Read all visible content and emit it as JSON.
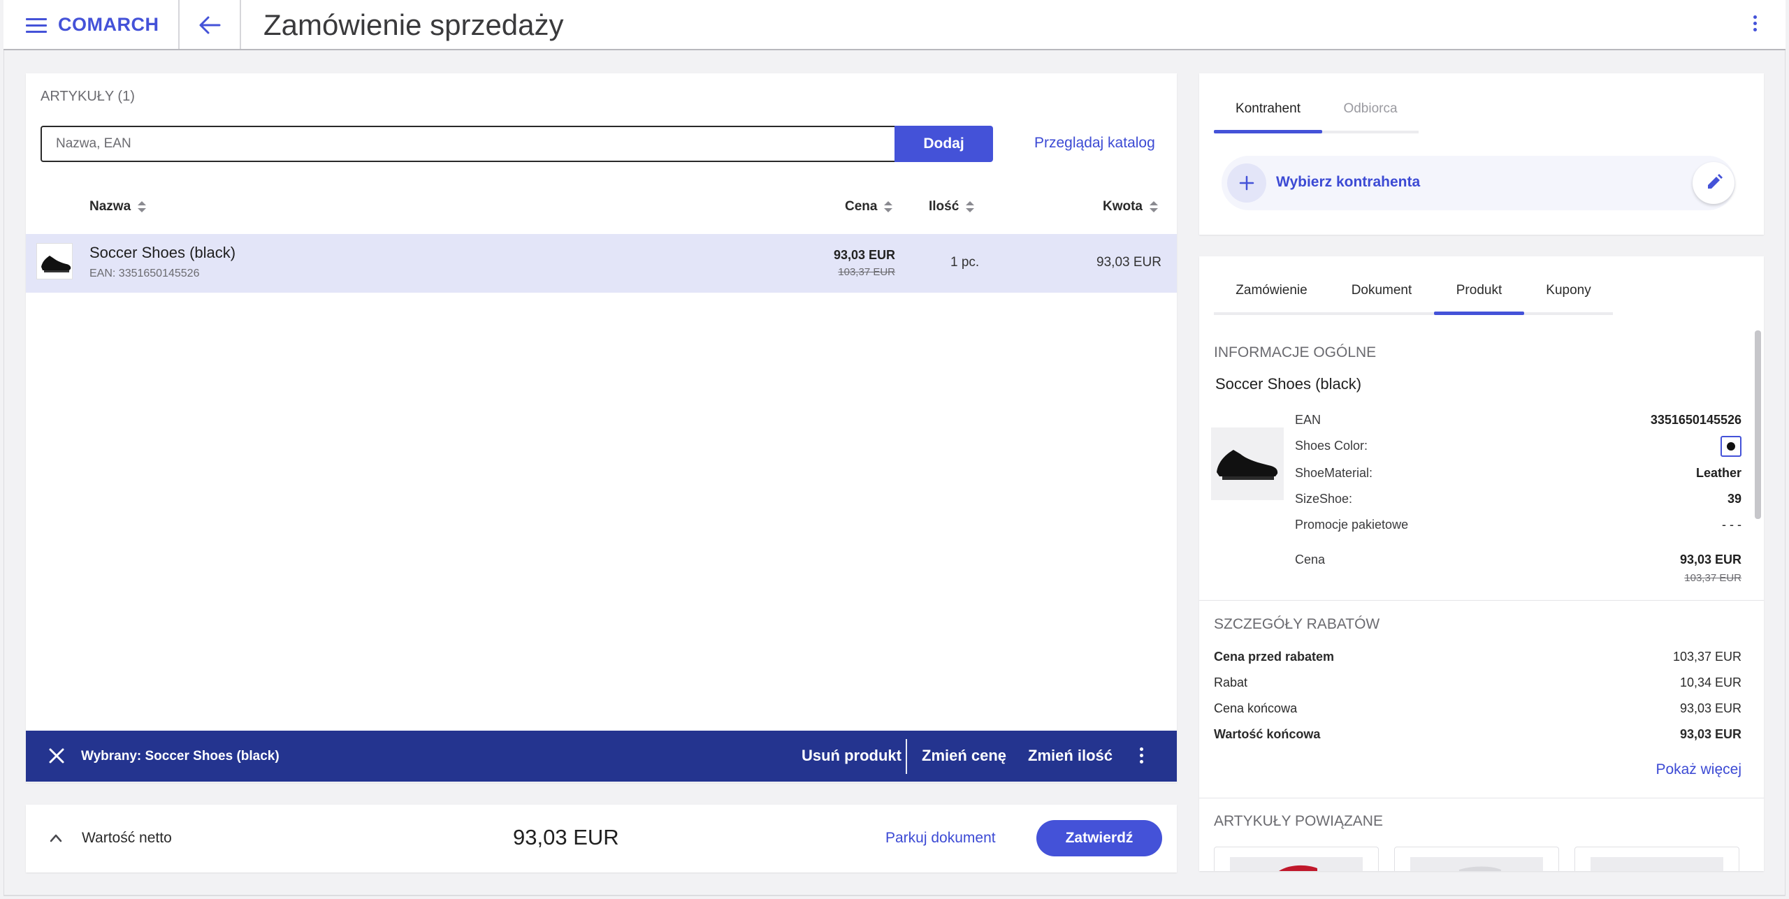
{
  "header": {
    "logo": "COMARCH",
    "title": "Zamówienie sprzedaży"
  },
  "articles": {
    "title": "ARTYKUŁY (1)",
    "search_placeholder": "Nazwa, EAN",
    "add_label": "Dodaj",
    "catalog_label": "Przeglądaj katalog",
    "columns": {
      "name": "Nazwa",
      "price": "Cena",
      "qty": "Ilość",
      "amount": "Kwota"
    },
    "rows": [
      {
        "name": "Soccer Shoes (black)",
        "ean": "EAN: 3351650145526",
        "price": "93,03 EUR",
        "old_price": "103,37 EUR",
        "qty": "1 pc.",
        "amount": "93,03 EUR"
      }
    ]
  },
  "selection_bar": {
    "label": "Wybrany: Soccer Shoes (black)",
    "remove": "Usuń produkt",
    "change_price": "Zmień cenę",
    "change_qty": "Zmień ilość"
  },
  "footer": {
    "net_label": "Wartość netto",
    "net_value": "93,03 EUR",
    "park_label": "Parkuj dokument",
    "confirm_label": "Zatwierdź"
  },
  "contractor": {
    "tabs": [
      "Kontrahent",
      "Odbiorca"
    ],
    "select_label": "Wybierz kontrahenta"
  },
  "details": {
    "tabs": [
      "Zamówienie",
      "Dokument",
      "Produkt",
      "Kupony"
    ],
    "general_title": "INFORMACJE OGÓLNE",
    "product_name": "Soccer Shoes (black)",
    "attributes": [
      {
        "label": "EAN",
        "value": "3351650145526"
      },
      {
        "label": "Shoes Color:",
        "value": ""
      },
      {
        "label": "ShoeMaterial:",
        "value": "Leather"
      },
      {
        "label": "SizeShoe:",
        "value": "39"
      },
      {
        "label": "Promocje pakietowe",
        "value": "- - -"
      }
    ],
    "price_label": "Cena",
    "price": "93,03 EUR",
    "old_price": "103,37 EUR",
    "discount_title": "SZCZEGÓŁY RABATÓW",
    "discounts": [
      {
        "label": "Cena przed rabatem",
        "value": "103,37 EUR"
      },
      {
        "label": "Rabat",
        "value": "10,34 EUR"
      },
      {
        "label": "Cena końcowa",
        "value": "93,03 EUR"
      },
      {
        "label": "Wartość końcowa",
        "value": "93,03 EUR"
      }
    ],
    "more_label": "Pokaż więcej",
    "related_title": "ARTYKUŁY POWIĄZANE"
  },
  "colors": {
    "accent": "#4452d8",
    "selection_bar": "#24348f",
    "row_highlight": "#e3e5f8"
  }
}
